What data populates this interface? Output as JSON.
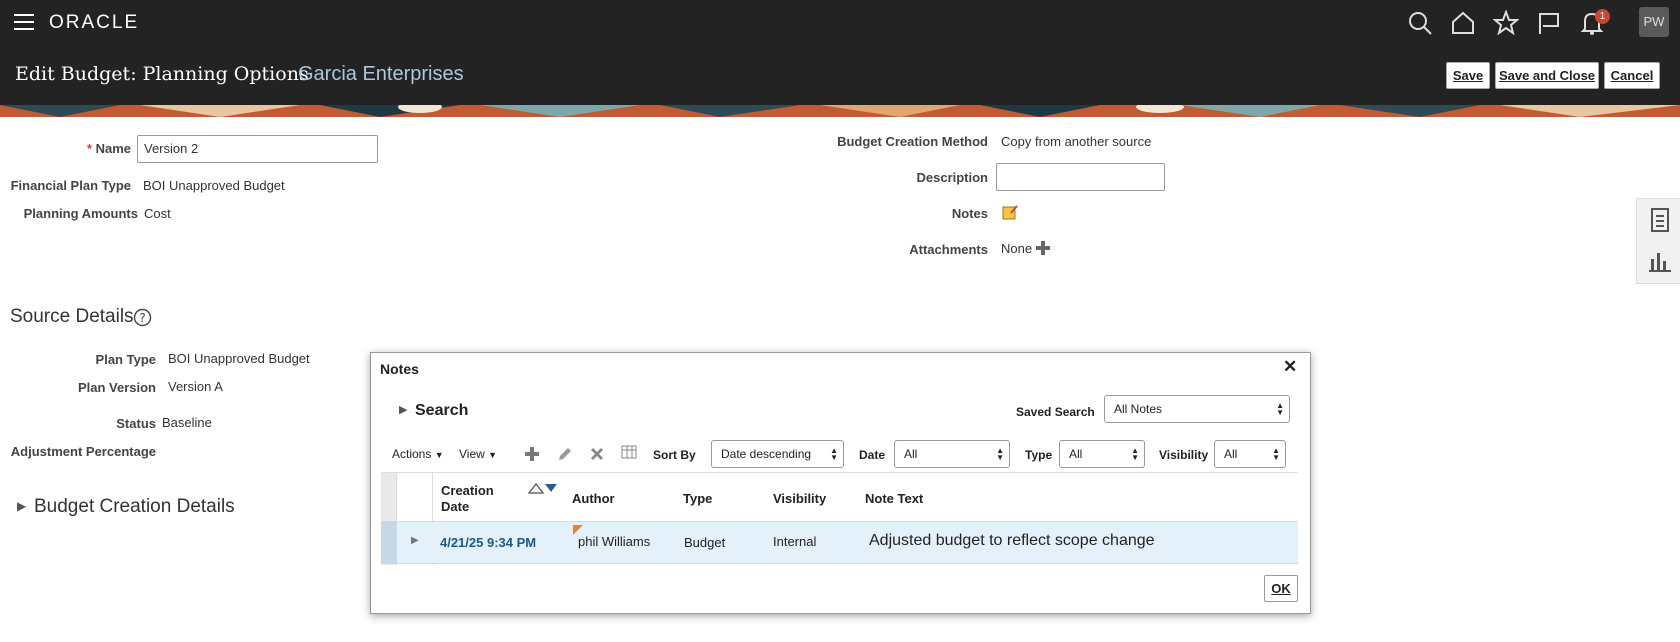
{
  "header": {
    "logo": "ORACLE",
    "notification_count": "1",
    "avatar_initials": "PW",
    "icons": [
      "menu-icon",
      "search-icon",
      "home-icon",
      "favorites-star-icon",
      "flag-icon",
      "bell-icon"
    ]
  },
  "page": {
    "title": "Edit Budget: Planning Options",
    "subtitle": "Garcia Enterprises",
    "save_label": "Save",
    "save_close_label": "Save and Close",
    "cancel_label": "Cancel"
  },
  "form": {
    "required_mark": "*",
    "name_label": "Name",
    "name_value": "Version 2",
    "financial_plan_type_label": "Financial Plan Type",
    "financial_plan_type_value": "BOI Unapproved Budget",
    "planning_amounts_label": "Planning Amounts",
    "planning_amounts_value": "Cost",
    "budget_creation_method_label": "Budget Creation Method",
    "budget_creation_method_value": "Copy from another source",
    "description_label": "Description",
    "description_value": "",
    "notes_label": "Notes",
    "attachments_label": "Attachments",
    "attachments_value": "None"
  },
  "source_details": {
    "heading": "Source Details",
    "plan_type_label": "Plan Type",
    "plan_type_value": "BOI Unapproved Budget",
    "plan_version_label": "Plan Version",
    "plan_version_value": "Version A",
    "status_label": "Status",
    "status_value": "Baseline",
    "adjustment_percentage_label": "Adjustment Percentage"
  },
  "budget_creation_details": {
    "heading": "Budget Creation Details"
  },
  "notes_dialog": {
    "title": "Notes",
    "search_label": "Search",
    "saved_search_label": "Saved Search",
    "saved_search_value": "All Notes",
    "actions_label": "Actions",
    "view_label": "View",
    "sort_by_label": "Sort By",
    "sort_by_value": "Date descending",
    "date_label": "Date",
    "date_value": "All",
    "type_label": "Type",
    "type_value": "All",
    "visibility_label": "Visibility",
    "visibility_value": "All",
    "columns": [
      "Creation Date",
      "Author",
      "Type",
      "Visibility",
      "Note Text"
    ],
    "rows": [
      {
        "creation_date": "4/21/25 9:34 PM",
        "author": "phil Williams",
        "type": "Budget",
        "visibility": "Internal",
        "note_text": "Adjusted budget to reflect scope change"
      }
    ],
    "ok_label": "OK"
  },
  "colors": {
    "header_bg": "#232323",
    "subtitle": "#a9c8d9",
    "link": "#1a5b85",
    "selected_row": "#e4f0fa",
    "badge": "#c74634"
  }
}
